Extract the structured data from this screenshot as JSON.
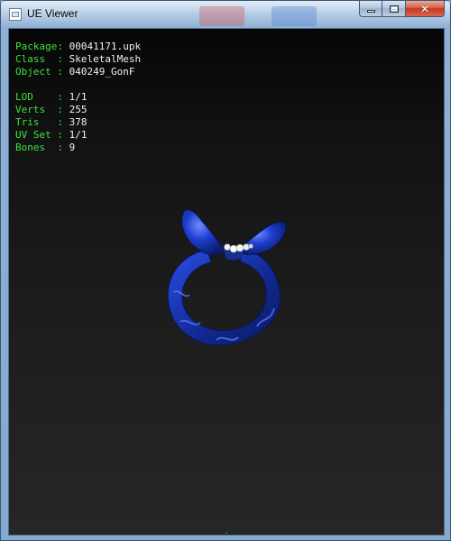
{
  "window": {
    "title": "UE Viewer",
    "controls": {
      "minimize": "minimize",
      "maximize": "maximize",
      "close": "close"
    }
  },
  "info": {
    "rows": [
      {
        "key": "Package",
        "value": "00041171.upk"
      },
      {
        "key": "Class  ",
        "value": "SkeletalMesh"
      },
      {
        "key": "Object ",
        "value": "040249_GonF"
      },
      {
        "key": "LOD    ",
        "value": "1/1"
      },
      {
        "key": "Verts  ",
        "value": "255"
      },
      {
        "key": "Tris   ",
        "value": "378"
      },
      {
        "key": "UV Set ",
        "value": "1/1"
      },
      {
        "key": "Bones  ",
        "value": "9"
      }
    ],
    "separator": ": "
  },
  "colors": {
    "info_key": "#3ee43e",
    "info_value": "#f0f0f0",
    "ribbon_blue": "#1f3ecf",
    "viewport_top": "#060606",
    "viewport_bottom": "#262626"
  },
  "viewport": {
    "model_icon": "blue-ribbon-ring-icon"
  }
}
